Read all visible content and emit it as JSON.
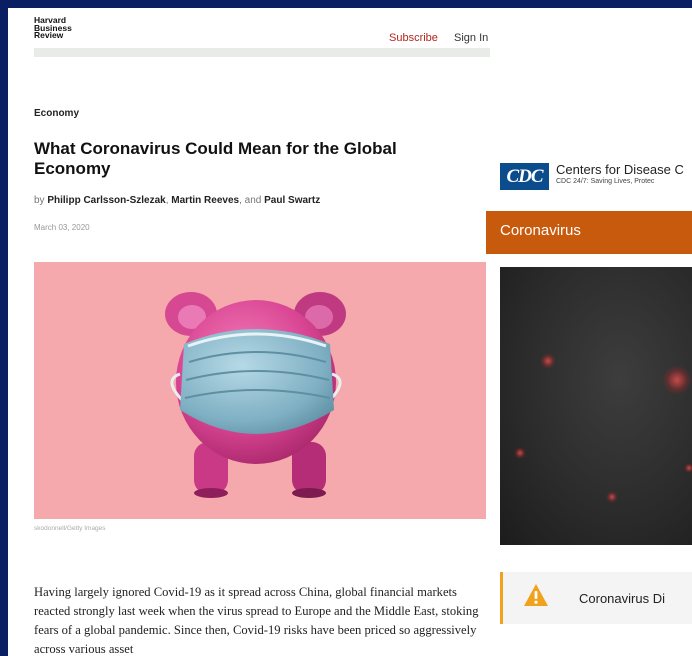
{
  "hbr": {
    "logo": [
      "Harvard",
      "Business",
      "Review"
    ],
    "nav": {
      "subscribe": "Subscribe",
      "sign_in": "Sign In"
    }
  },
  "article": {
    "section": "Economy",
    "title": "What Coronavirus Could Mean for the Global Economy",
    "byline_prefix": "by",
    "authors": [
      "Philipp Carlsson-Szlezak",
      "Martin Reeves",
      "Paul Swartz"
    ],
    "byline_sep1": ",",
    "byline_sep2": ", and",
    "date": "March 03, 2020",
    "photo_credit": "skodonnell/Getty Images",
    "body": "Having largely ignored Covid-19 as it spread across China, global financial markets reacted strongly last week when the virus spread to Europe and the Middle East, stoking fears of a global pandemic. Since then, Covid-19 risks have been priced so aggressively across various asset"
  },
  "cdc": {
    "logo_text": "CDC",
    "name": "Centers for Disease C",
    "tagline": "CDC 24/7: Saving Lives, Protec",
    "section_title": "Coronavirus",
    "alert_text": "Coronavirus Di"
  },
  "colors": {
    "page_frame": "#0a1f63",
    "hbr_red": "#b3251d",
    "cdc_orange": "#c85a0e",
    "cdc_blue": "#0a4c8c",
    "warning_amber": "#f0a21c",
    "hero_pink": "#f6a9ad"
  },
  "icons": {
    "alert": "warning-triangle-icon",
    "hero": "piggy-bank-with-mask-illustration"
  }
}
